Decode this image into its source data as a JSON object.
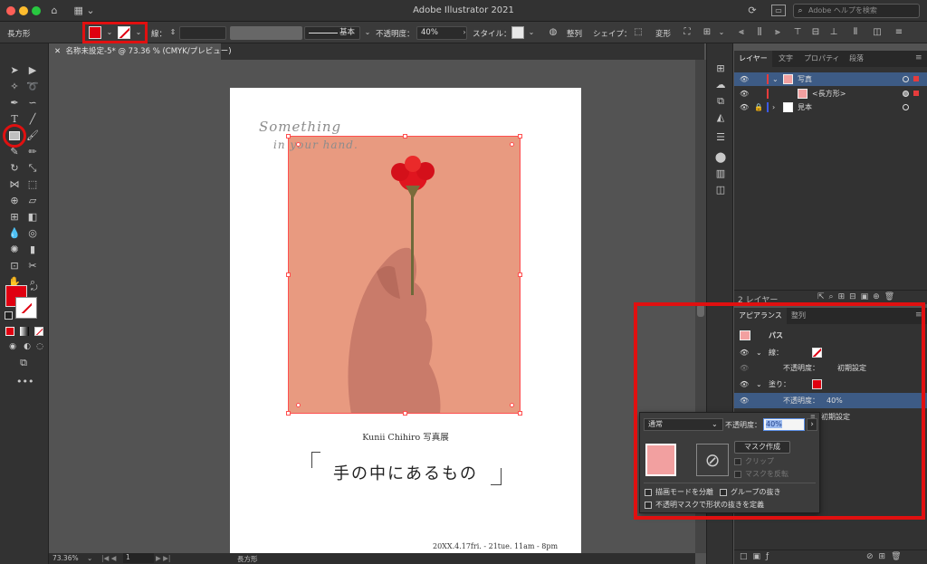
{
  "window": {
    "title": "Adobe Illustrator 2021",
    "help_placeholder": "Adobe ヘルプを検索"
  },
  "control_bar": {
    "object_type": "長方形",
    "stroke_label": "線：",
    "stroke_style": "基本",
    "opacity_label": "不透明度：",
    "opacity_value": "40%",
    "style_label": "スタイル：",
    "align_label": "整列",
    "shape_label": "シェイプ：",
    "transform_label": "変形",
    "fill_color": "#e00010"
  },
  "document": {
    "tab_label": "名称未設定-5* @ 73.36 % (CMYK/プレビュー)"
  },
  "artboard": {
    "script_line1": "Something",
    "script_line2": "in your hand.",
    "exhibit_name": "Kunii Chihiro 写真展",
    "main_title": "手の中にあるもの",
    "date_line": "20XX.4.17fri. - 21tue.  11am - 8pm",
    "photo_color": "#e89a80"
  },
  "status_bar": {
    "zoom": "73.36%",
    "artboard_number": "1",
    "tool_name": "長方形"
  },
  "layers_panel": {
    "tabs": [
      "レイヤー",
      "文字",
      "プロパティ",
      "段落"
    ],
    "rows": [
      {
        "name": "写真"
      },
      {
        "name": "<長方形>"
      },
      {
        "name": "見本"
      }
    ],
    "footer": "2 レイヤー"
  },
  "appearance_panel": {
    "tabs": [
      "アピアランス",
      "整列"
    ],
    "object": "パス",
    "stroke_label": "線：",
    "stroke_opacity_label": "不透明度：",
    "stroke_opacity_value": "初期設定",
    "fill_label": "塗り：",
    "fill_opacity_label": "不透明度：",
    "fill_opacity_value": "40%",
    "object_opacity_value": "初期設定"
  },
  "transparency_popup": {
    "blend_mode": "通常",
    "opacity_label": "不透明度：",
    "opacity_value": "40%",
    "make_mask": "マスク作成",
    "clip": "クリップ",
    "invert_mask": "マスクを反転",
    "isolate_blending": "描画モードを分離",
    "knockout_group": "グループの抜き",
    "opacity_mask_define": "不透明マスクで形状の抜きを定義"
  }
}
